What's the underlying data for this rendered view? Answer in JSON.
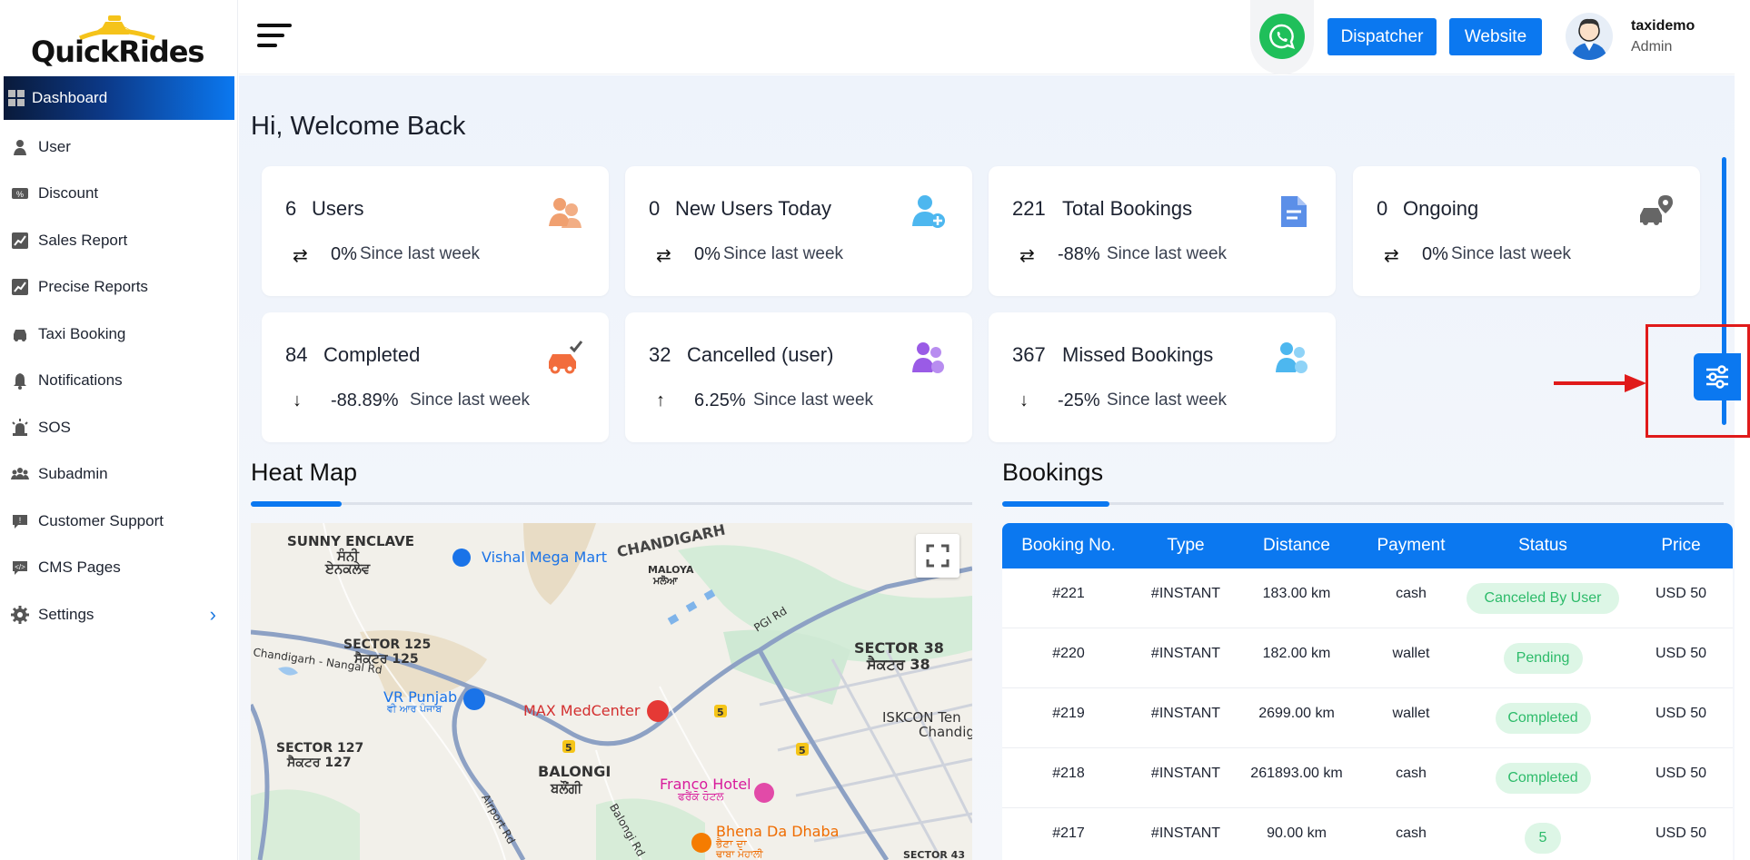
{
  "brand": {
    "logo_text_a": "Quick",
    "logo_text_b": "Rides",
    "accent": "#0b78f0"
  },
  "sidebar": {
    "items": [
      {
        "label": "Dashboard",
        "icon": "dashboard-icon",
        "active": true
      },
      {
        "label": "User",
        "icon": "user-icon"
      },
      {
        "label": "Discount",
        "icon": "discount-icon"
      },
      {
        "label": "Sales Report",
        "icon": "chart-icon"
      },
      {
        "label": "Precise Reports",
        "icon": "chart-icon"
      },
      {
        "label": "Taxi Booking",
        "icon": "car-icon"
      },
      {
        "label": "Notifications",
        "icon": "bell-icon"
      },
      {
        "label": "SOS",
        "icon": "alarm-icon"
      },
      {
        "label": "Subadmin",
        "icon": "group-icon"
      },
      {
        "label": "Customer Support",
        "icon": "chat-icon"
      },
      {
        "label": "CMS Pages",
        "icon": "code-chat-icon"
      },
      {
        "label": "Settings",
        "icon": "gear-icon"
      }
    ]
  },
  "header": {
    "dispatcher_label": "Dispatcher",
    "website_label": "Website",
    "user_name": "taxidemo",
    "user_role": "Admin"
  },
  "welcome": "Hi, Welcome Back",
  "cards": [
    {
      "num": "6",
      "label": "Users",
      "pct": "0%",
      "since": "Since last week",
      "trend": "⇄",
      "icon": "users-icon",
      "color": "#f0a070"
    },
    {
      "num": "0",
      "label": "New Users Today",
      "pct": "0%",
      "since": "Since last week",
      "trend": "⇄",
      "icon": "add-user-icon",
      "color": "#4db7ef"
    },
    {
      "num": "221",
      "label": "Total Bookings",
      "pct": "-88%",
      "since": "Since last week",
      "trend": "⇄",
      "icon": "document-icon",
      "color": "#5b8fe8"
    },
    {
      "num": "0",
      "label": "Ongoing",
      "pct": "0%",
      "since": "Since last week",
      "trend": "⇄",
      "icon": "car-location-icon",
      "color": "#666"
    },
    {
      "num": "84",
      "label": "Completed",
      "pct": "-88.89%",
      "since": "Since last week",
      "trend": "↓",
      "icon": "car-check-icon",
      "color": "#f26d3d"
    },
    {
      "num": "32",
      "label": "Cancelled (user)",
      "pct": "6.25%",
      "since": "Since last week",
      "trend": "↑",
      "icon": "users-cancel-icon",
      "color": "#9a5be6"
    },
    {
      "num": "367",
      "label": "Missed Bookings",
      "pct": "-25%",
      "since": "Since last week",
      "trend": "↓",
      "icon": "users-missed-icon",
      "color": "#4db7ef"
    }
  ],
  "heatmap": {
    "title": "Heat Map",
    "labels": {
      "sunny": "SUNNY ENCLAVE",
      "sunny_pa": "ਸੰਨੀ\nਏਨਕਲੇਵ",
      "chandigarh": "CHANDIGARH",
      "maloya": "MALOYA",
      "maloya_pa": "ਮਲੋਆ",
      "sector125": "SECTOR 125",
      "sector125_pa": "ਸੈਕਟਰ 125",
      "sector38": "SECTOR 38",
      "sector38_pa": "ਸੈਕਟਰ 38",
      "sector127": "SECTOR 127",
      "sector127_pa": "ਸੈਕਟਰ 127",
      "balongi": "BALONGI",
      "balongi_pa": "ਬਲੌਂਗੀ",
      "iskcon": "ISKCON Ten",
      "iskcon2": "Chandig",
      "sector43": "SECTOR 43",
      "vishal": "Vishal Mega Mart",
      "vrpunjab": "VR Punjab",
      "vrpunjab_pa": "ਵੀ ਆਰ ਪੰਜਾਬ",
      "max": "MAX MedCenter",
      "franco": "Franco Hotel",
      "franco_pa": "ਫਰੈਂਕੋ ਹੋਟਲ",
      "bhena": "Bhena Da Dhaba",
      "bhena_pa": "ਭੈਣਾ ਦਾ",
      "bhena_pa2": "ਢਾਬਾ ਮੋਹਾਲੀ",
      "nangal": "Chandigarh - Nangal Rd",
      "pgi": "PGI Rd",
      "airport": "Airport Rd",
      "balongird": "Balongi Rd",
      "route5": "5"
    }
  },
  "bookings": {
    "title": "Bookings",
    "columns": [
      "Booking No.",
      "Type",
      "Distance",
      "Payment",
      "Status",
      "Price"
    ],
    "rows": [
      {
        "no": "#221",
        "type": "#INSTANT",
        "distance": "183.00 km",
        "payment": "cash",
        "status": "Canceled By User",
        "price": "USD 50"
      },
      {
        "no": "#220",
        "type": "#INSTANT",
        "distance": "182.00 km",
        "payment": "wallet",
        "status": "Pending",
        "price": "USD 50"
      },
      {
        "no": "#219",
        "type": "#INSTANT",
        "distance": "2699.00 km",
        "payment": "wallet",
        "status": "Completed",
        "price": "USD 50"
      },
      {
        "no": "#218",
        "type": "#INSTANT",
        "distance": "261893.00 km",
        "payment": "cash",
        "status": "Completed",
        "price": "USD 50"
      },
      {
        "no": "#217",
        "type": "#INSTANT",
        "distance": "90.00 km",
        "payment": "cash",
        "status": "5",
        "price": "USD 50"
      }
    ]
  }
}
